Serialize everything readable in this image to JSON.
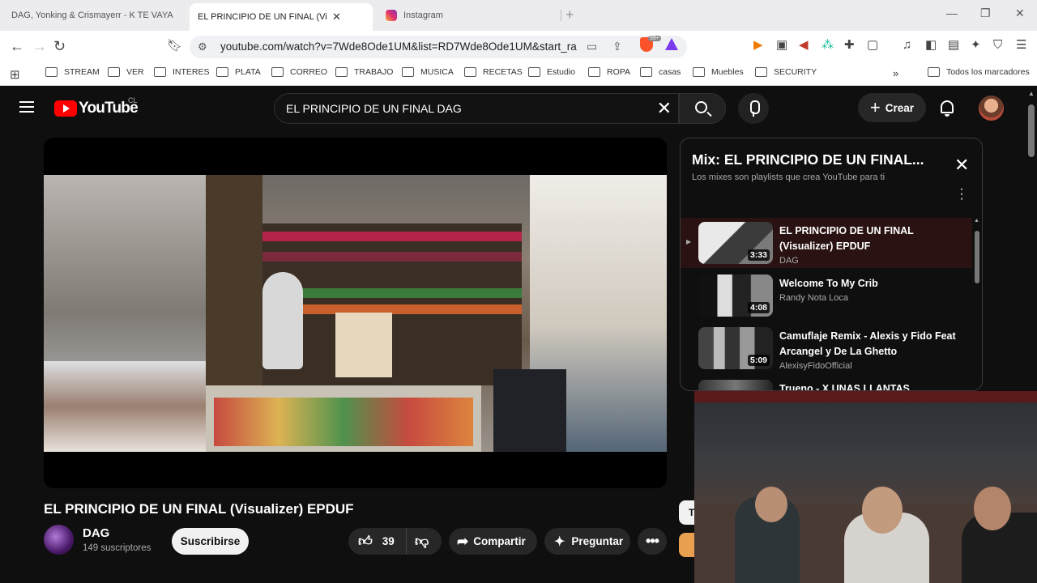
{
  "browser": {
    "tabs": [
      {
        "title": "DAG, Yonking & Crismayerr - K TE VAYA",
        "favicon": "youtube-icon"
      },
      {
        "title": "EL PRINCIPIO DE UN FINAL (Visualiz",
        "favicon": "youtube-icon",
        "active": true
      },
      {
        "title": "Instagram",
        "favicon": "instagram-icon"
      }
    ],
    "url": "youtube.com/watch?v=7Wde8Ode1UM&list=RD7Wde8Ode1UM&start_ra...",
    "brave_badge": "99+",
    "bookmarks": [
      "STREAM",
      "VER",
      "INTERES",
      "PLATA",
      "CORREO",
      "TRABAJO",
      "MUSICA",
      "RECETAS",
      "Estudio",
      "ROPA",
      "casas",
      "Muebles",
      "SECURITY"
    ],
    "other_bookmarks": "Todos los marcadores"
  },
  "youtube": {
    "logo_text": "YouTube",
    "country_code": "CL",
    "search_query": "EL PRINCIPIO DE UN FINAL DAG",
    "create_label": "Crear",
    "video": {
      "title": "EL PRINCIPIO DE UN FINAL (Visualizer) EPDUF",
      "channel": "DAG",
      "subscribers": "149 suscriptores",
      "subscribe_label": "Suscribirse",
      "likes": "39",
      "share_label": "Compartir",
      "ask_label": "Preguntar",
      "peek_label": "Te"
    },
    "playlist": {
      "title": "Mix: EL PRINCIPIO DE UN FINAL...",
      "subtitle": "Los mixes son playlists que crea YouTube para ti",
      "items": [
        {
          "title": "EL PRINCIPIO DE UN FINAL (Visualizer) EPDUF",
          "channel": "DAG",
          "duration": "3:33",
          "current": true
        },
        {
          "title": "Welcome To My Crib",
          "channel": "Randy Nota Loca",
          "duration": "4:08"
        },
        {
          "title": "Camuflaje Remix - Alexis y Fido Feat Arcangel y De La Ghetto",
          "channel": "AlexisyFidoOfficial",
          "duration": "5:09"
        },
        {
          "title": "Trueno - X UNAS LLANTAS",
          "channel": "",
          "duration": ""
        }
      ]
    }
  },
  "colors": {
    "youtube_red": "#ff0000",
    "background": "#0f0f0f",
    "current_item_bg": "#2a1212"
  }
}
